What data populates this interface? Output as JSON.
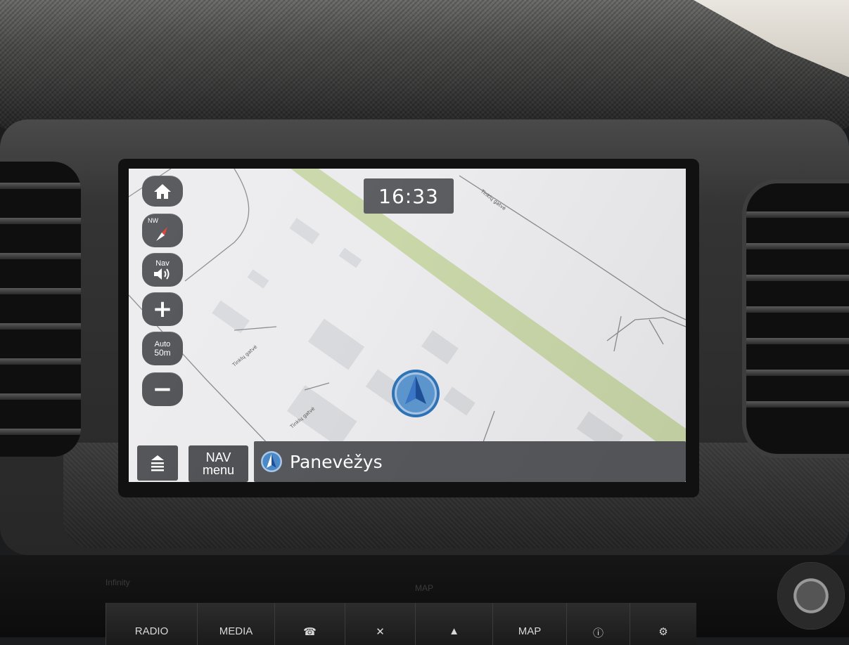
{
  "time": "16:33",
  "map": {
    "street_labels": [
      "Tinklų gatvė",
      "Tinklų gatvė",
      "Tinklų gatvė"
    ],
    "colors": {
      "background": "#ececef",
      "park": "#c9d7a9",
      "buildings": "#d9dadd",
      "roads": "#8a8c90"
    },
    "position_marker_icon": "navigation-arrow-icon"
  },
  "side_buttons": {
    "home": {
      "icon": "home-icon"
    },
    "compass": {
      "label": "NW",
      "icon": "compass-needle-icon"
    },
    "nav_volume": {
      "label": "Nav",
      "icon": "speaker-icon"
    },
    "zoom_in": {
      "label": "+"
    },
    "zoom_scale": {
      "line1": "Auto",
      "line2": "50m"
    },
    "zoom_out": {
      "label": "−"
    }
  },
  "bottom_bar": {
    "menu_icon": "menu-icon",
    "nav_menu": {
      "line1": "NAV",
      "line2": "menu"
    },
    "location": {
      "icon": "navigation-arrow-icon",
      "name": "Panevėžys"
    }
  },
  "console": {
    "top_label": "MAP",
    "left_label": "Infinity",
    "buttons": [
      "RADIO",
      "MEDIA",
      "",
      "",
      "",
      "MAP",
      "",
      ""
    ],
    "button_icons": [
      "",
      "",
      "phone-icon",
      "close-icon",
      "up-arrow-icon",
      "",
      "info-icon",
      "gear-icon"
    ]
  }
}
